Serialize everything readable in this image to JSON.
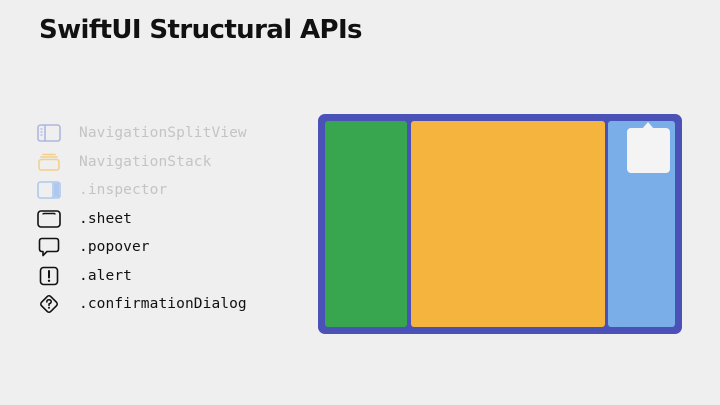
{
  "slide": {
    "title": "SwiftUI Structural APIs"
  },
  "api_list": [
    {
      "label": "NavigationSplitView",
      "icon": "sidebar-split-icon",
      "dimmed": true,
      "icon_color": "#aeb6e0"
    },
    {
      "label": "NavigationStack",
      "icon": "stack-icon",
      "dimmed": true,
      "icon_color": "#f2cf8a"
    },
    {
      "label": ".inspector",
      "icon": "inspector-icon",
      "dimmed": true,
      "icon_color": "#aec8ee"
    },
    {
      "label": ".sheet",
      "icon": "sheet-icon",
      "dimmed": false,
      "icon_color": "#111111"
    },
    {
      "label": ".popover",
      "icon": "popover-bubble-icon",
      "dimmed": false,
      "icon_color": "#111111"
    },
    {
      "label": ".alert",
      "icon": "alert-icon",
      "dimmed": false,
      "icon_color": "#111111"
    },
    {
      "label": ".confirmationDialog",
      "icon": "confirmation-dialog-icon",
      "dimmed": false,
      "icon_color": "#111111"
    }
  ],
  "illustration": {
    "frame_color": "#4a52b8",
    "sidebar_color": "#38a64e",
    "content_color": "#f5b43e",
    "inspector_color": "#7aaee8",
    "popover_color": "#f4f4f4"
  }
}
